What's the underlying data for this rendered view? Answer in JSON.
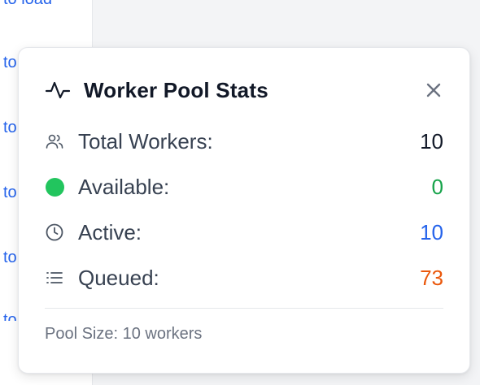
{
  "background": {
    "links": [
      "to load",
      "to",
      "to",
      "to",
      "to",
      "to"
    ]
  },
  "popover": {
    "title": "Worker Pool Stats",
    "stats": [
      {
        "label": "Total Workers:",
        "value": "10",
        "icon": "users-icon",
        "color": "#111827"
      },
      {
        "label": "Available:",
        "value": "0",
        "icon": "green-dot-icon",
        "color": "#16a34a"
      },
      {
        "label": "Active:",
        "value": "10",
        "icon": "clock-icon",
        "color": "#2563eb"
      },
      {
        "label": "Queued:",
        "value": "73",
        "icon": "list-icon",
        "color": "#ea580c"
      }
    ],
    "footer": "Pool Size: 10 workers"
  },
  "colors": {
    "link": "#2563eb",
    "available": "#22c55e"
  }
}
